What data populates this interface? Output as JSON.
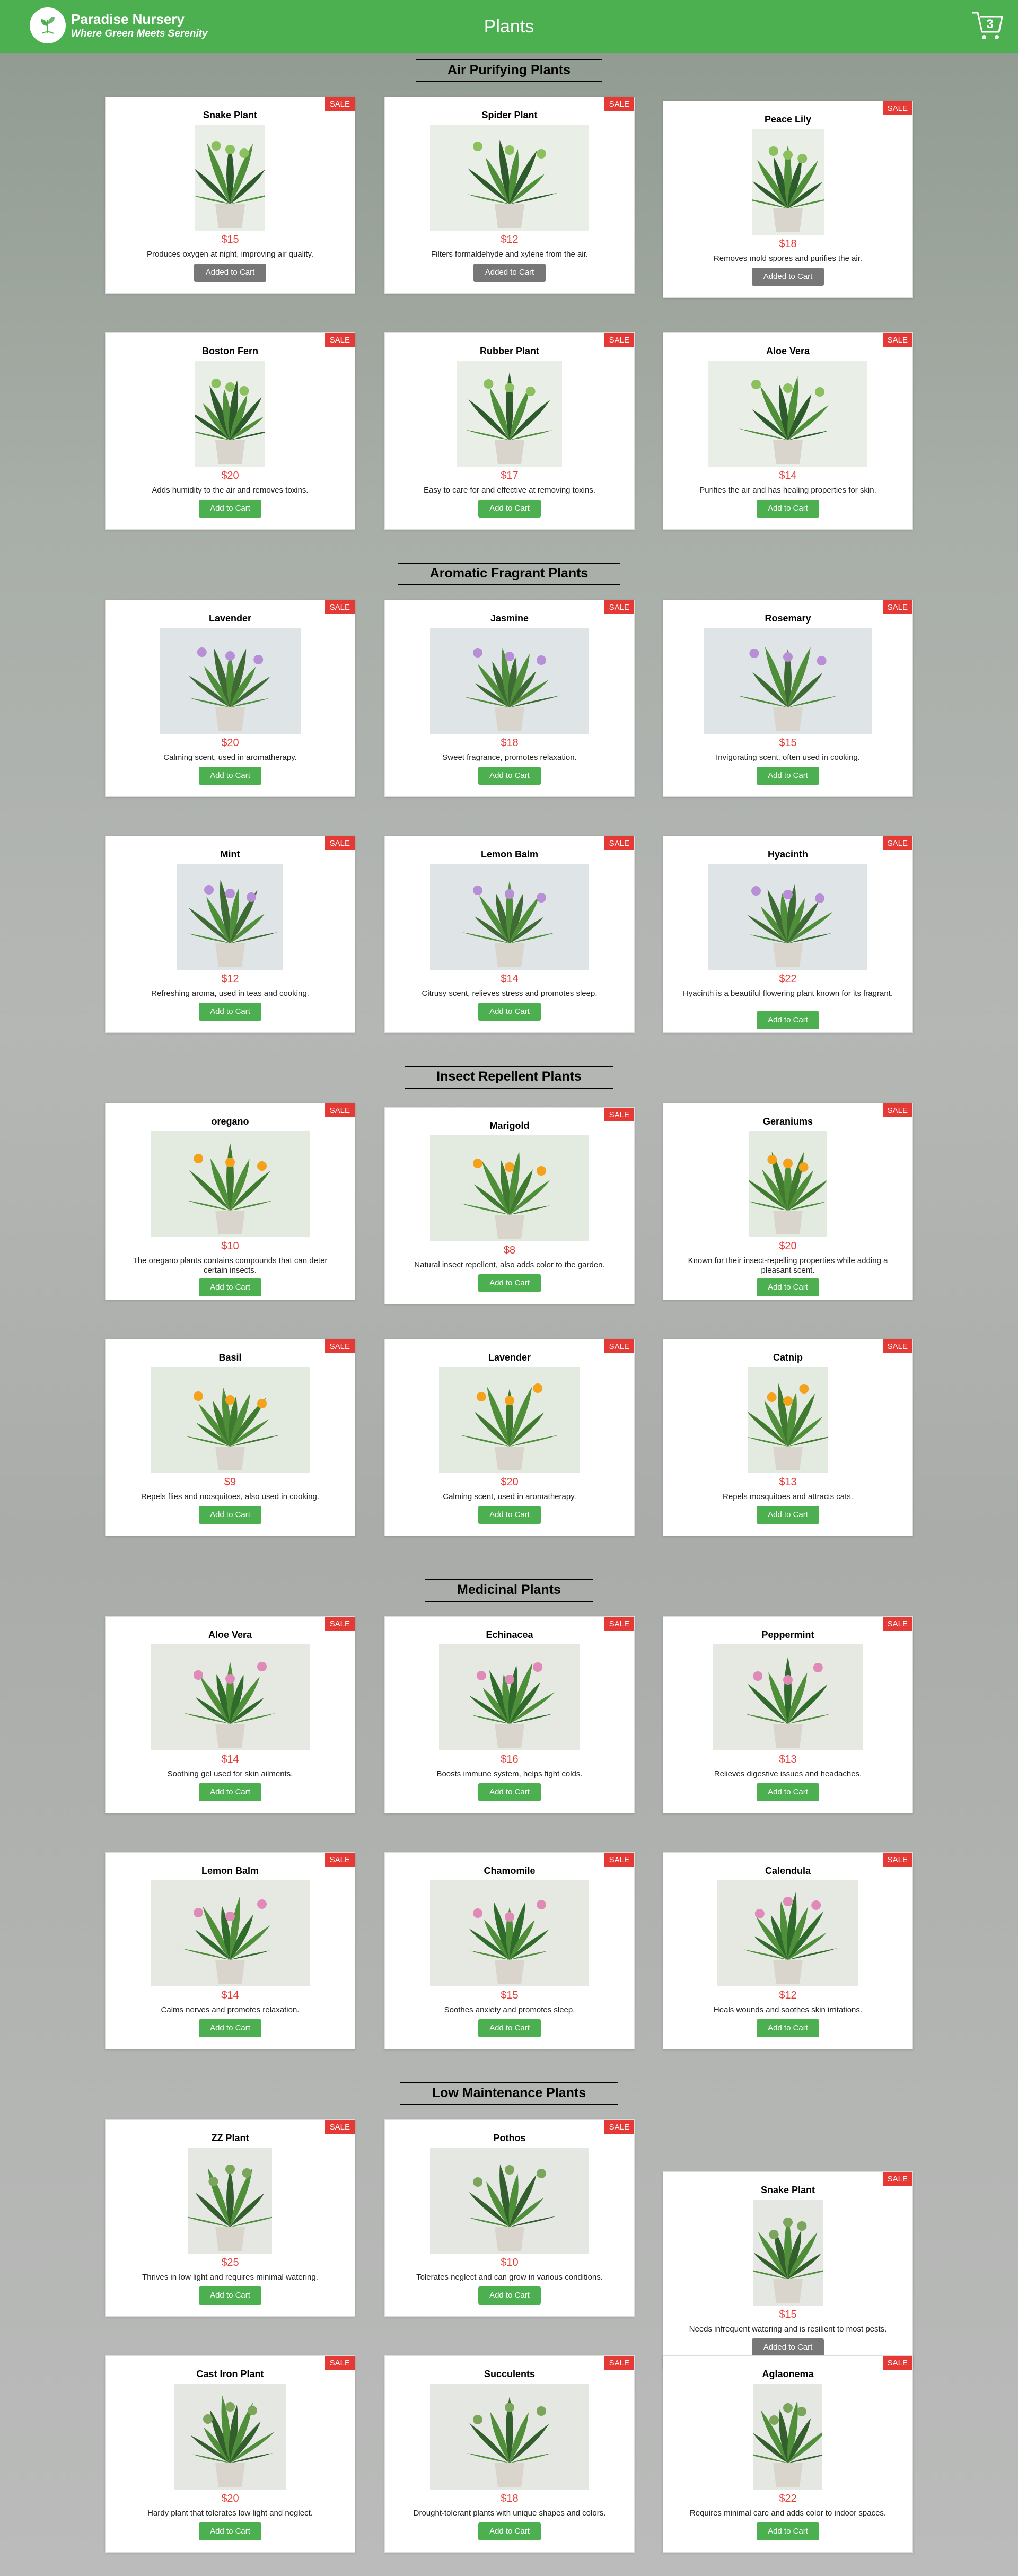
{
  "header": {
    "brand_name": "Paradise Nursery",
    "tagline": "Where Green Meets Serenity",
    "page_title": "Plants",
    "cart_count": "3",
    "colors": {
      "nav": "#4caf50",
      "sale": "#e53935",
      "added": "#777777"
    },
    "icons": [
      "leaf-logo-icon",
      "cart-icon"
    ]
  },
  "labels": {
    "sale": "SALE",
    "add": "Add to Cart",
    "added": "Added to Cart"
  },
  "categories": [
    {
      "name": "Air Purifying Plants",
      "plants": [
        {
          "name": "Snake Plant",
          "price": "$15",
          "desc": "Produces oxygen at night, improving air quality.",
          "added": true
        },
        {
          "name": "Spider Plant",
          "price": "$12",
          "desc": "Filters formaldehyde and xylene from the air.",
          "added": true
        },
        {
          "name": "Peace Lily",
          "price": "$18",
          "desc": "Removes mold spores and purifies the air.",
          "added": true
        },
        {
          "name": "Boston Fern",
          "price": "$20",
          "desc": "Adds humidity to the air and removes toxins.",
          "added": false
        },
        {
          "name": "Rubber Plant",
          "price": "$17",
          "desc": "Easy to care for and effective at removing toxins.",
          "added": false
        },
        {
          "name": "Aloe Vera",
          "price": "$14",
          "desc": "Purifies the air and has healing properties for skin.",
          "added": false
        }
      ]
    },
    {
      "name": "Aromatic Fragrant Plants",
      "plants": [
        {
          "name": "Lavender",
          "price": "$20",
          "desc": "Calming scent, used in aromatherapy.",
          "added": false
        },
        {
          "name": "Jasmine",
          "price": "$18",
          "desc": "Sweet fragrance, promotes relaxation.",
          "added": false
        },
        {
          "name": "Rosemary",
          "price": "$15",
          "desc": "Invigorating scent, often used in cooking.",
          "added": false
        },
        {
          "name": "Mint",
          "price": "$12",
          "desc": "Refreshing aroma, used in teas and cooking.",
          "added": false
        },
        {
          "name": "Lemon Balm",
          "price": "$14",
          "desc": "Citrusy scent, relieves stress and promotes sleep.",
          "added": false
        },
        {
          "name": "Hyacinth",
          "price": "$22",
          "desc": "Hyacinth is a beautiful flowering plant known for its fragrant.",
          "added": false
        }
      ]
    },
    {
      "name": "Insect Repellent Plants",
      "plants": [
        {
          "name": "oregano",
          "price": "$10",
          "desc": "The oregano plants contains compounds that can deter certain insects.",
          "added": false
        },
        {
          "name": "Marigold",
          "price": "$8",
          "desc": "Natural insect repellent, also adds color to the garden.",
          "added": false
        },
        {
          "name": "Geraniums",
          "price": "$20",
          "desc": "Known for their insect-repelling properties while adding a pleasant scent.",
          "added": false
        },
        {
          "name": "Basil",
          "price": "$9",
          "desc": "Repels flies and mosquitoes, also used in cooking.",
          "added": false
        },
        {
          "name": "Lavender",
          "price": "$20",
          "desc": "Calming scent, used in aromatherapy.",
          "added": false
        },
        {
          "name": "Catnip",
          "price": "$13",
          "desc": "Repels mosquitoes and attracts cats.",
          "added": false
        }
      ]
    },
    {
      "name": "Medicinal Plants",
      "plants": [
        {
          "name": "Aloe Vera",
          "price": "$14",
          "desc": "Soothing gel used for skin ailments.",
          "added": false
        },
        {
          "name": "Echinacea",
          "price": "$16",
          "desc": "Boosts immune system, helps fight colds.",
          "added": false
        },
        {
          "name": "Peppermint",
          "price": "$13",
          "desc": "Relieves digestive issues and headaches.",
          "added": false
        },
        {
          "name": "Lemon Balm",
          "price": "$14",
          "desc": "Calms nerves and promotes relaxation.",
          "added": false
        },
        {
          "name": "Chamomile",
          "price": "$15",
          "desc": "Soothes anxiety and promotes sleep.",
          "added": false
        },
        {
          "name": "Calendula",
          "price": "$12",
          "desc": "Heals wounds and soothes skin irritations.",
          "added": false
        }
      ]
    },
    {
      "name": "Low Maintenance Plants",
      "plants": [
        {
          "name": "ZZ Plant",
          "price": "$25",
          "desc": "Thrives in low light and requires minimal watering.",
          "added": false
        },
        {
          "name": "Pothos",
          "price": "$10",
          "desc": "Tolerates neglect and can grow in various conditions.",
          "added": false
        },
        {
          "name": "Snake Plant",
          "price": "$15",
          "desc": "Needs infrequent watering and is resilient to most pests.",
          "added": true
        },
        {
          "name": "Cast Iron Plant",
          "price": "$20",
          "desc": "Hardy plant that tolerates low light and neglect.",
          "added": false
        },
        {
          "name": "Succulents",
          "price": "$18",
          "desc": "Drought-tolerant plants with unique shapes and colors.",
          "added": false
        },
        {
          "name": "Aglaonema",
          "price": "$22",
          "desc": "Requires minimal care and adds color to indoor spaces.",
          "added": false
        }
      ]
    }
  ]
}
